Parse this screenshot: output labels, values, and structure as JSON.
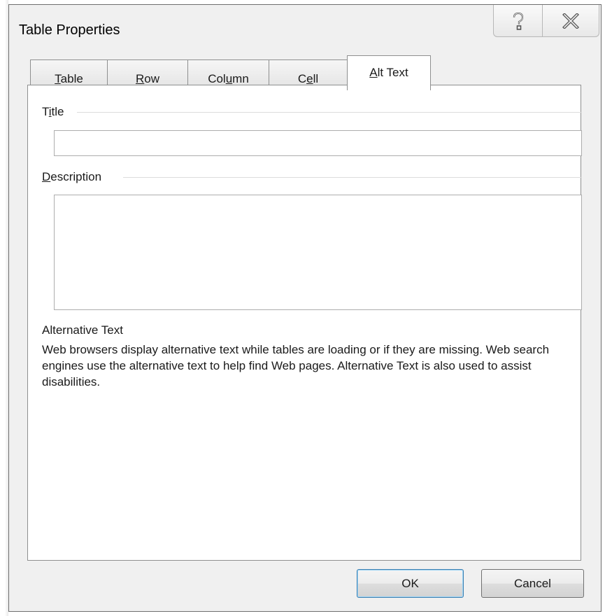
{
  "window": {
    "title": "Table Properties",
    "help_glyph": "?",
    "close_glyph": "X"
  },
  "tabs": [
    {
      "label_pre": "",
      "label_u": "T",
      "label_post": "able",
      "active": false
    },
    {
      "label_pre": "",
      "label_u": "R",
      "label_post": "ow",
      "active": false
    },
    {
      "label_pre": "Col",
      "label_u": "u",
      "label_post": "mn",
      "active": false
    },
    {
      "label_pre": "C",
      "label_u": "e",
      "label_post": "ll",
      "active": false
    },
    {
      "label_pre": "",
      "label_u": "A",
      "label_post": "lt Text",
      "active": true
    }
  ],
  "alt_text": {
    "title_label_pre": "T",
    "title_label_u": "i",
    "title_label_post": "tle",
    "title_value": "",
    "description_label_u": "D",
    "description_label_post": "escription",
    "description_value": "",
    "info_heading": "Alternative Text",
    "info_text": "Web browsers display alternative text while tables are loading or if they are missing.  Web search engines use the alternative text to help find Web pages.  Alternative Text is also used to assist disabilities."
  },
  "buttons": {
    "ok": "OK",
    "cancel": "Cancel"
  },
  "colors": {
    "dialog_bg": "#f0f0f0",
    "panel_bg": "#ffffff",
    "default_button_border": "#3c7fb1"
  }
}
